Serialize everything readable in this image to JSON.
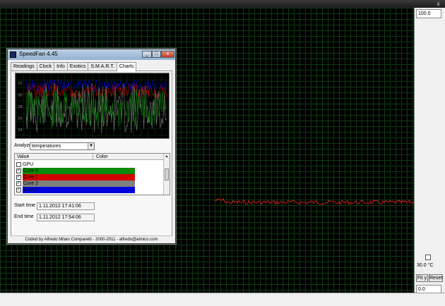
{
  "window": {
    "close_label": "x"
  },
  "right_panel": {
    "max_value": "100.0",
    "temperature_label": "30.0 °C",
    "fit_label": "Fit y",
    "reset_label": "Reset",
    "min_value": "0.0"
  },
  "speedfan": {
    "title": "SpeedFan 4.45",
    "tabs": [
      "Readings",
      "Clock",
      "Info",
      "Exotics",
      "S.M.A.R.T.",
      "Charts"
    ],
    "active_tab": "Charts",
    "analyze_label": "Analyze",
    "analyze_value": "temperatures",
    "list_headers": {
      "value": "Value",
      "color": "Color"
    },
    "list_items": [
      {
        "label": "GPU",
        "checked": false,
        "color": ""
      },
      {
        "label": "Core 0",
        "checked": true,
        "color": "#0a8a0a"
      },
      {
        "label": "Core 1",
        "checked": true,
        "color": "#d40000"
      },
      {
        "label": "Core 2",
        "checked": true,
        "color": "#808080"
      },
      {
        "label": "Core 3",
        "checked": true,
        "color": "#0000e0"
      }
    ],
    "start_time_label": "Start time",
    "start_time_value": "1.11.2012 17:41:06",
    "end_time_label": "End time",
    "end_time_value": "1.11.2012 17:54:06",
    "footer": "Coded by Alfredo Milani Comparetti - 2000-2011 - alfredo@almico.com",
    "y_ticks": [
      "32",
      "30",
      "28",
      "26",
      "24"
    ]
  },
  "colors": {
    "grid_line": "#0f3a12",
    "trace": "#ff2020"
  }
}
